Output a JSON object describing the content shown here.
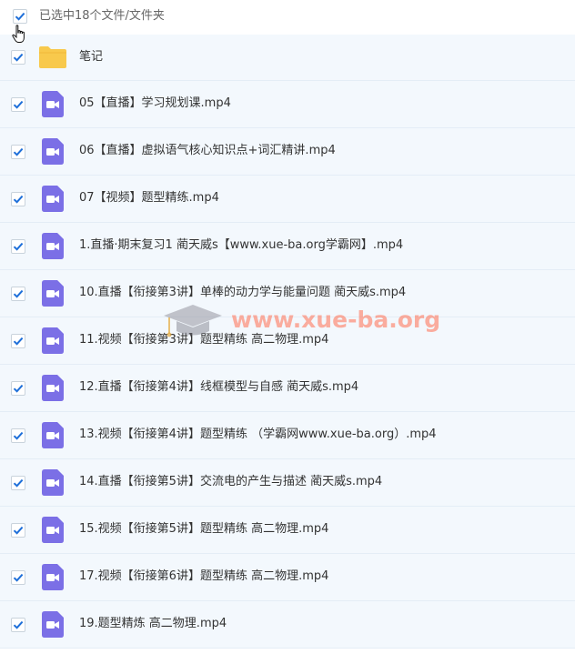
{
  "header": {
    "selection_text": "已选中18个文件/文件夹"
  },
  "files": [
    {
      "name": "笔记",
      "type": "folder"
    },
    {
      "name": "05【直播】学习规划课.mp4",
      "type": "video"
    },
    {
      "name": "06【直播】虚拟语气核心知识点+词汇精讲.mp4",
      "type": "video"
    },
    {
      "name": "07【视频】题型精练.mp4",
      "type": "video"
    },
    {
      "name": "1.直播·期末复习1 蔺天威s【www.xue-ba.org学霸网】.mp4",
      "type": "video"
    },
    {
      "name": "10.直播【衔接第3讲】单棒的动力学与能量问题 蔺天威s.mp4",
      "type": "video"
    },
    {
      "name": "11.视频【衔接第3讲】题型精练 高二物理.mp4",
      "type": "video"
    },
    {
      "name": "12.直播【衔接第4讲】线框模型与自感 蔺天威s.mp4",
      "type": "video"
    },
    {
      "name": "13.视频【衔接第4讲】题型精练 （学霸网www.xue-ba.org）.mp4",
      "type": "video"
    },
    {
      "name": "14.直播【衔接第5讲】交流电的产生与描述 蔺天威s.mp4",
      "type": "video"
    },
    {
      "name": "15.视频【衔接第5讲】题型精练 高二物理.mp4",
      "type": "video"
    },
    {
      "name": "17.视频【衔接第6讲】题型精练 高二物理.mp4",
      "type": "video"
    },
    {
      "name": "19.题型精炼 高二物理.mp4",
      "type": "video"
    }
  ],
  "watermark": {
    "text": "www.xue-ba.org"
  },
  "colors": {
    "checkbox_tick": "#1e6fd9",
    "row_background": "#f3f8fd",
    "folder": "#f8c94c",
    "video_icon": "#7b6fe6"
  }
}
